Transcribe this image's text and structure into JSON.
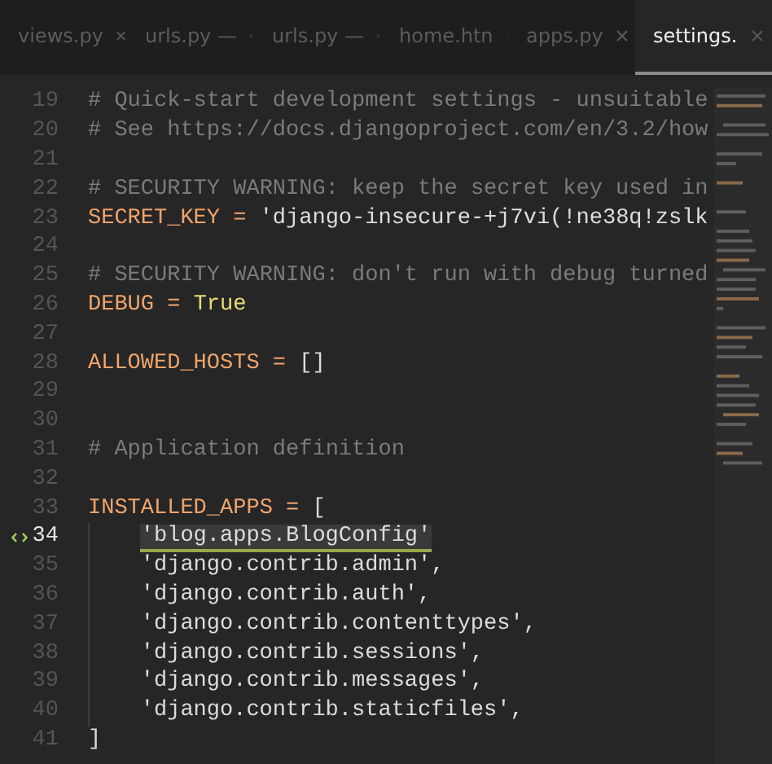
{
  "tabs": [
    {
      "label": "views.py",
      "selected": false
    },
    {
      "label": "urls.py —",
      "selected": false
    },
    {
      "label": "urls.py —",
      "selected": false
    },
    {
      "label": "home.htn",
      "selected": false
    },
    {
      "label": "apps.py",
      "selected": false
    },
    {
      "label": "settings.",
      "selected": true
    }
  ],
  "lines": [
    {
      "number": "19",
      "current": false,
      "indented": false,
      "tokens": [
        {
          "kind": "comment",
          "text": "# Quick-start development settings - unsuitable"
        }
      ]
    },
    {
      "number": "20",
      "current": false,
      "indented": false,
      "tokens": [
        {
          "kind": "comment",
          "text": "# See https://docs.djangoproject.com/en/3.2/how"
        }
      ]
    },
    {
      "number": "21",
      "current": false,
      "indented": false
    },
    {
      "number": "22",
      "current": false,
      "indented": false,
      "tokens": [
        {
          "kind": "comment",
          "text": "# SECURITY WARNING: keep the secret key used in"
        }
      ]
    },
    {
      "number": "23",
      "current": false,
      "indented": false,
      "tokens": [
        {
          "kind": "name",
          "text": "SECRET_KEY = "
        },
        {
          "kind": "string",
          "text": "'django-insecure-+j7vi(!ne38q!zslk"
        }
      ]
    },
    {
      "number": "24",
      "current": false,
      "indented": false
    },
    {
      "number": "25",
      "current": false,
      "indented": false,
      "tokens": [
        {
          "kind": "comment",
          "text": "# SECURITY WARNING: don't run with debug turned"
        }
      ]
    },
    {
      "number": "26",
      "current": false,
      "indented": false,
      "tokens": [
        {
          "kind": "name",
          "text": "DEBUG = "
        },
        {
          "kind": "constant",
          "text": "True"
        }
      ]
    },
    {
      "number": "27",
      "current": false,
      "indented": false
    },
    {
      "number": "28",
      "current": false,
      "indented": false,
      "tokens": [
        {
          "kind": "name",
          "text": "ALLOWED_HOSTS = "
        },
        {
          "kind": "string",
          "text": "[]"
        }
      ]
    },
    {
      "number": "29",
      "current": false,
      "indented": false
    },
    {
      "number": "30",
      "current": false,
      "indented": false
    },
    {
      "number": "31",
      "current": false,
      "indented": false,
      "tokens": [
        {
          "kind": "comment",
          "text": "# Application definition"
        }
      ]
    },
    {
      "number": "32",
      "current": false,
      "indented": false
    },
    {
      "number": "33",
      "current": false,
      "indented": false,
      "tokens": [
        {
          "kind": "name",
          "text": "INSTALLED_APPS = "
        },
        {
          "kind": "string",
          "text": "["
        }
      ]
    },
    {
      "number": "34",
      "current": true,
      "indented": true,
      "tokens": [
        {
          "kind": "match",
          "text": "'blog.apps.BlogConfig'"
        }
      ]
    },
    {
      "number": "35",
      "current": false,
      "indented": true,
      "tokens": [
        {
          "kind": "string",
          "text": "'django.contrib.admin',"
        }
      ]
    },
    {
      "number": "36",
      "current": false,
      "indented": true,
      "tokens": [
        {
          "kind": "string",
          "text": "'django.contrib.auth',"
        }
      ]
    },
    {
      "number": "37",
      "current": false,
      "indented": true,
      "tokens": [
        {
          "kind": "string",
          "text": "'django.contrib.contenttypes',"
        }
      ]
    },
    {
      "number": "38",
      "current": false,
      "indented": true,
      "tokens": [
        {
          "kind": "string",
          "text": "'django.contrib.sessions',"
        }
      ]
    },
    {
      "number": "39",
      "current": false,
      "indented": true,
      "tokens": [
        {
          "kind": "string",
          "text": "'django.contrib.messages',"
        }
      ]
    },
    {
      "number": "40",
      "current": false,
      "indented": true,
      "tokens": [
        {
          "kind": "string",
          "text": "'django.contrib.staticfiles',"
        }
      ]
    },
    {
      "number": "41",
      "current": false,
      "indented": false,
      "tokens": [
        {
          "kind": "string",
          "text": "]"
        }
      ]
    }
  ]
}
